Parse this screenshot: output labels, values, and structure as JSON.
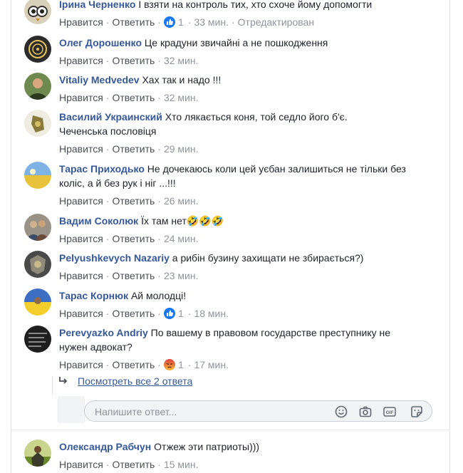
{
  "actions": {
    "like": "Нравится",
    "reply": "Ответить",
    "sep": "·"
  },
  "comments": [
    {
      "author": "Ірина Черненко",
      "text": "І взяти на контроль тих, хто схоче йому допомогти",
      "reaction": "like",
      "reaction_count": "1",
      "time": "33 мин.",
      "edited": "Отредактирован"
    },
    {
      "author": "Олег Дорошенко",
      "text": "Це крадуни звичайні а не пошкодження",
      "time": "32 мин."
    },
    {
      "author": "Vitaliy Medvedev",
      "text": "Хах так и надо !!!",
      "time": "32 мин."
    },
    {
      "author": "Василий Украинский",
      "text": "Хто лякається коня, той седло його б'є.",
      "text2": "Чеченська пословіця",
      "time": "29 мин."
    },
    {
      "author": "Тарас Приходько",
      "text": "Не дочекаюсь коли цей уєбан залишиться не тільки без",
      "text2": "коліс, а й без рук і ніг ...!!!",
      "time": "26 мин."
    },
    {
      "author": "Вадим Соколюк",
      "text": "Їх там нет🤣🤣🤣",
      "time": "24 мин."
    },
    {
      "author": "Pelyushkevych Nazariy",
      "text": "а рибін бузину захищати не збирається?)",
      "time": "23 мин."
    },
    {
      "author": "Тарас Корнюк",
      "text": "Ай молодці!",
      "reaction": "like",
      "reaction_count": "1",
      "time": "18 мин."
    },
    {
      "author": "Perevyazko Andriy",
      "text": "По вашему в правовом государстве преступнику не",
      "text2": "нужен адвокат?",
      "reaction": "angry",
      "reaction_count": "1",
      "time": "17 мин."
    },
    {
      "author": "Олександр Рабчун",
      "text": "Отжеж эти патриоты)))",
      "time": "15 мин."
    }
  ],
  "view_replies": "Посмотреть все 2 ответа",
  "reply_box": {
    "placeholder": "Напишите ответ..."
  },
  "colors": {
    "author": "#365899",
    "muted": "#90949c",
    "like": "#1877f2",
    "angry": "#e9710f"
  }
}
